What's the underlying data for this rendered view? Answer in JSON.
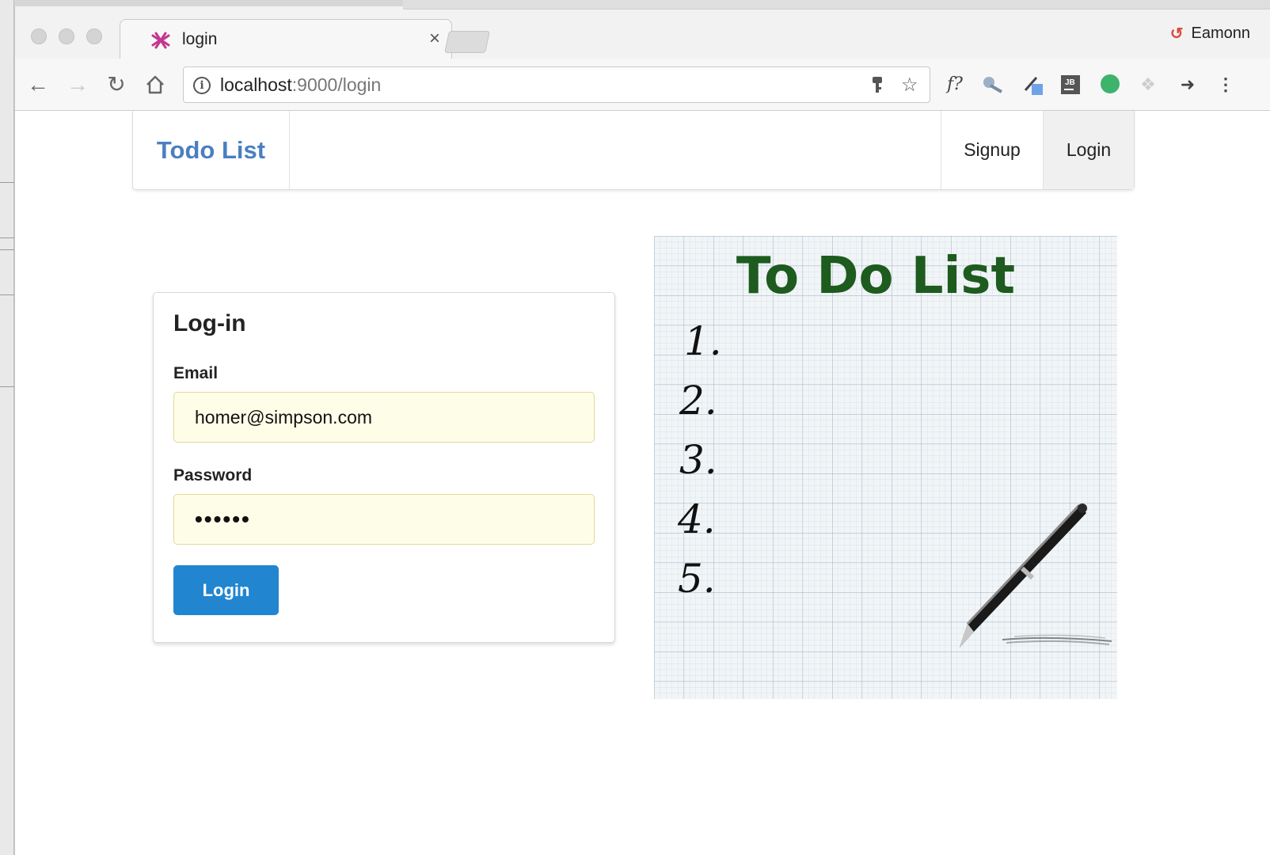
{
  "browser": {
    "tab_title": "login",
    "tab_close": "×",
    "profile_name": "Eamonn",
    "url_host": "localhost",
    "url_rest": ":9000/login",
    "extension_fx_label": "f?",
    "extension_jb_label": "JB"
  },
  "navbar": {
    "brand": "Todo List",
    "links": [
      {
        "label": "Signup",
        "active": false
      },
      {
        "label": "Login",
        "active": true
      }
    ]
  },
  "login_form": {
    "title": "Log-in",
    "email_label": "Email",
    "email_value": "homer@simpson.com",
    "password_label": "Password",
    "password_value": "••••••",
    "submit_label": "Login"
  },
  "illustration": {
    "title": "To Do List",
    "numbers": [
      "1.",
      "2.",
      "3.",
      "4.",
      "5."
    ]
  },
  "colors": {
    "brand": "#4a7fc1",
    "primary_button": "#2185d0",
    "autofill_bg": "#fefee8",
    "illustration_title": "#1e5b1e"
  }
}
